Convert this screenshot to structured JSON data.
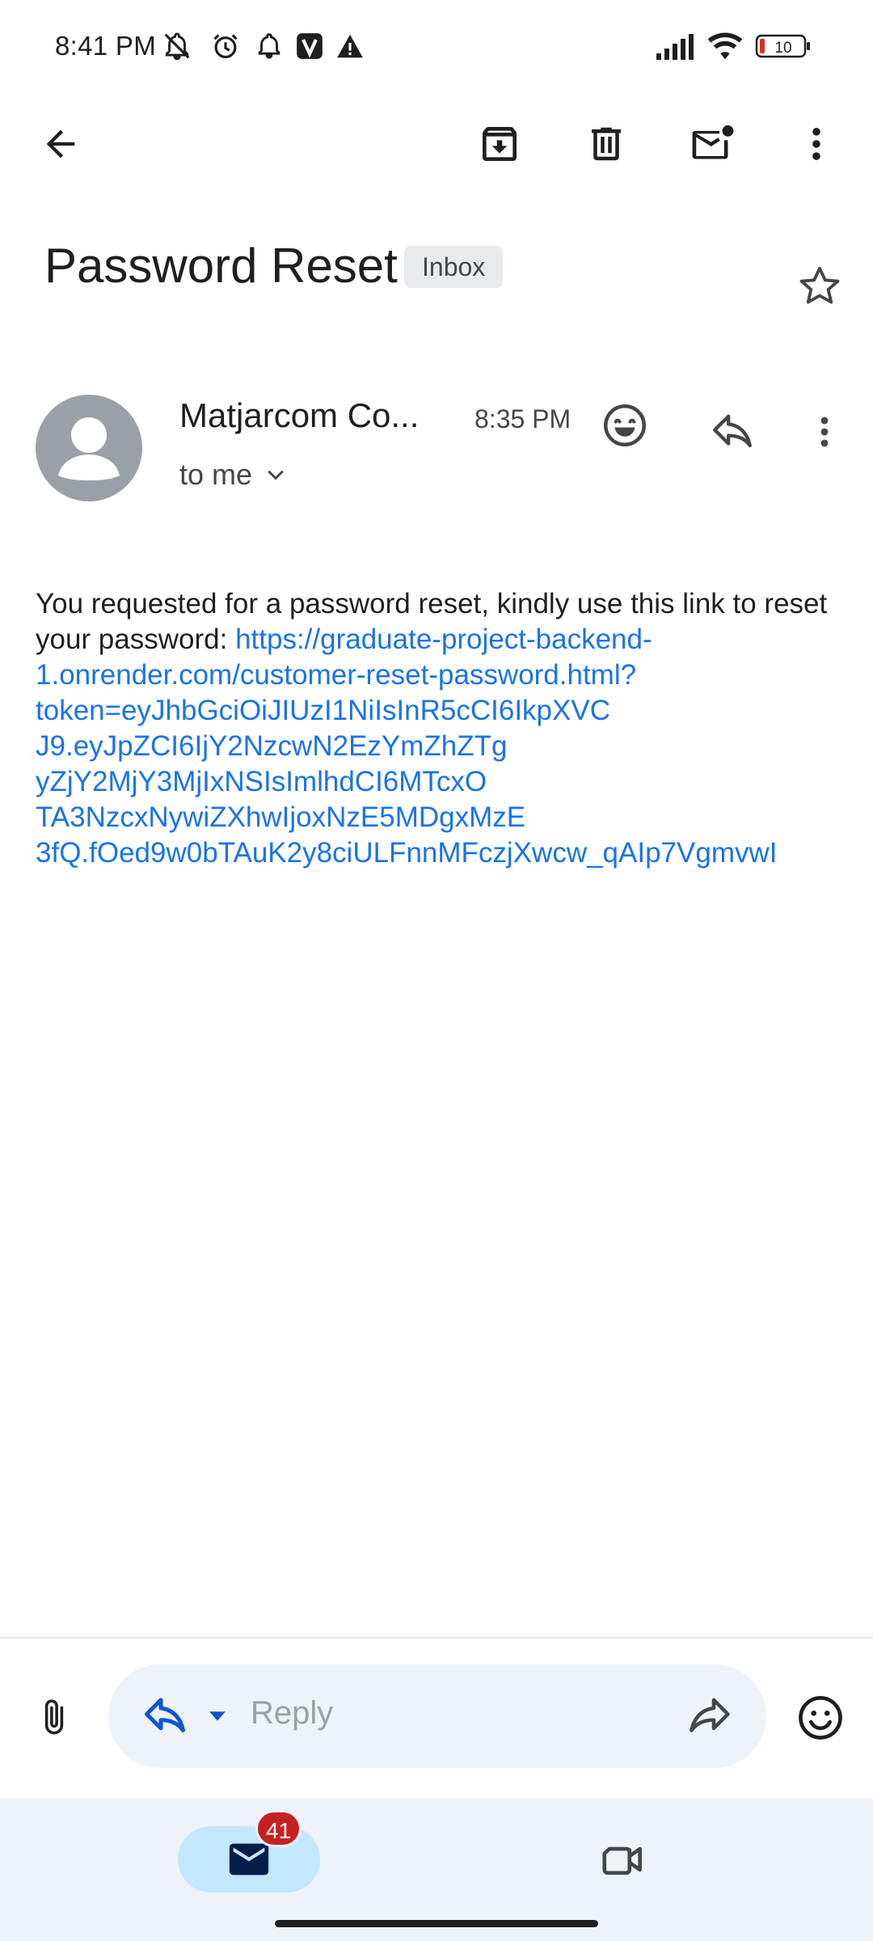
{
  "status_bar": {
    "time": "8:41 PM",
    "battery": "10",
    "icons": [
      "muted-notifications-icon",
      "alarm-icon",
      "notification-bell-icon",
      "v-app-icon",
      "warning-icon",
      "signal-icon",
      "wifi-icon",
      "battery-icon"
    ]
  },
  "toolbar": {
    "icons": [
      "back-arrow-icon",
      "archive-icon",
      "delete-icon",
      "mark-unread-icon",
      "more-vert-icon"
    ]
  },
  "email": {
    "subject": "Password Reset",
    "label": "Inbox",
    "sender": "Matjarcom Co...",
    "time": "8:35 PM",
    "recipient": "to me",
    "body_text": "You requested for a password reset, kindly use this link to reset your password: ",
    "link_lines": [
      "https://graduate-project-backend-",
      "1.onrender.com/customer-reset-password.html?",
      "token=eyJhbGciOiJIUzI1NiIsInR5cCI6IkpXVC",
      "J9.eyJpZCI6IjY2NzcwN2EzYmZhZTg",
      "yZjY2MjY3MjIxNSIsImlhdCI6MTcxO",
      "TA3NzcxNywiZXhwIjoxNzE5MDgxMzE",
      "3fQ.fOed9w0bTAuK2y8ciULFnnMFczjXwcw_qAIp7VgmvwI"
    ],
    "link_color": "#1a73e8"
  },
  "reply_bar": {
    "placeholder": "Reply"
  },
  "bottom_nav": {
    "mail_badge": "41",
    "accent": "#c2e7ff",
    "badge_color": "#c5221f"
  }
}
